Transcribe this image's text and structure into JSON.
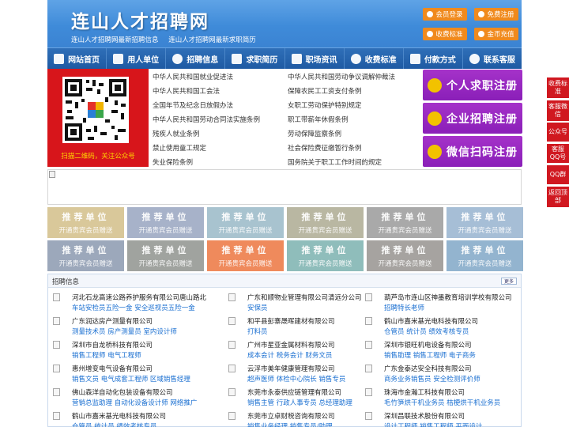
{
  "header": {
    "title": "连山人才招聘网",
    "subtitle": [
      "连山人才招聘网最新招聘信息",
      "连山人才招聘网最新求职简历"
    ],
    "buttons": [
      "会员登录",
      "免费注册",
      "收费标准",
      "金币充值"
    ]
  },
  "nav": {
    "items": [
      {
        "label": "网站首页",
        "icon": "home-icon"
      },
      {
        "label": "用人单位",
        "icon": "building-icon"
      },
      {
        "label": "招聘信息",
        "icon": "tag-icon"
      },
      {
        "label": "求职简历",
        "icon": "hand-icon"
      },
      {
        "label": "职场资讯",
        "icon": "news-icon"
      },
      {
        "label": "收费标准",
        "icon": "coin-icon"
      },
      {
        "label": "付款方式",
        "icon": "card-icon"
      },
      {
        "label": "联系客服",
        "icon": "phone-icon"
      }
    ]
  },
  "qr": {
    "caption": "扫描二维码，关注公众号"
  },
  "laws": [
    "中华人民共和国就业促进法",
    "中华人民共和国劳动争议调解仲裁法",
    "中华人民共和国工会法",
    "保障农民工工资支付条例",
    "全国年节及纪念日放假办法",
    "女职工劳动保护特别规定",
    "中华人民共和国劳动合同法实施条例",
    "职工带薪年休假条例",
    "残疾人就业条例",
    "劳动保障监察条例",
    "禁止使用童工规定",
    "社会保险费征缴暂行条例",
    "失业保险条例",
    "国务院关于职工工作时间的规定"
  ],
  "register": [
    "个人求职注册",
    "企业招聘注册",
    "微信扫码注册"
  ],
  "float_menu": [
    "收费标准",
    "客服微信",
    "公众号",
    "客服QQ号",
    "QQ群",
    "返回顶部"
  ],
  "ads": {
    "title": "推荐单位",
    "subtitle": "开通贵宾会员赠送",
    "colors": [
      "#d9c89a",
      "#a7b2c9",
      "#a8c3cf",
      "#b9b7a2",
      "#a9a9a9",
      "#a6bed6",
      "#9ca8bb",
      "#a0a39f",
      "#ef8a5c",
      "#8fbdbb",
      "#a6a3a0",
      "#93b4cf"
    ]
  },
  "jobs": {
    "title": "招聘信息",
    "more": "更多",
    "items": [
      {
        "company": "河北石龙高速公路养护服务有限公司唐山路北",
        "positions": "车站安检员五险一金 安全巡视员五险一金"
      },
      {
        "company": "广东和顺物业管理有限公司清远分公司",
        "positions": "安保员"
      },
      {
        "company": "葫芦岛市连山区神墨教育培训学校有限公司",
        "positions": "招聘特长老师"
      },
      {
        "company": "广东润达房产测量有限公司",
        "positions": "测量技术员 房产测量员 室内设计师"
      },
      {
        "company": "和平县彭寨晟晖建材有限公司",
        "positions": "打料员"
      },
      {
        "company": "鹤山市嘉米基光电科技有限公司",
        "positions": "仓管员 统计员 绩效考核专员"
      },
      {
        "company": "深圳市自龙桥科技有限公司",
        "positions": "销售工程师 电气工程师"
      },
      {
        "company": "广州市星亚金属材料有限公司",
        "positions": "成本会计 税务会计 财务文员"
      },
      {
        "company": "深圳市银旺机电设备有限公司",
        "positions": "销售助理 销售工程师 电子商务"
      },
      {
        "company": "惠州增变电气设备有限公司",
        "positions": "销售文员 电气成套工程师 区域销售经理"
      },
      {
        "company": "云浮市美年健康管理有限公司",
        "positions": "超声医师 体检中心院长 销售专员"
      },
      {
        "company": "广东金泰达安全科技有限公司",
        "positions": "商务业务销售员 安全检测评价师"
      },
      {
        "company": "佛山森洋自动化包装设备有限公司",
        "positions": "营销总监助理 自动化设备设计师 网络推广"
      },
      {
        "company": "东莞市永泰供应链管理有限公司",
        "positions": "销售主管 行政人事专员 总经理助理"
      },
      {
        "company": "珠海市金瀚工科技有限公司",
        "positions": "毛竹笋烘干机业务员 桔梗烘干机业务员"
      },
      {
        "company": "鹤山市嘉米基光电科技有限公司",
        "positions": "仓管员 统计员 绩效考核专员"
      },
      {
        "company": "东莞市立卓财税咨询有限公司",
        "positions": "销售业务经理 销售专员/助理"
      },
      {
        "company": "深圳昌联技术股份有限公司",
        "positions": "设计工程师 销售工程师 平面设计"
      }
    ]
  }
}
